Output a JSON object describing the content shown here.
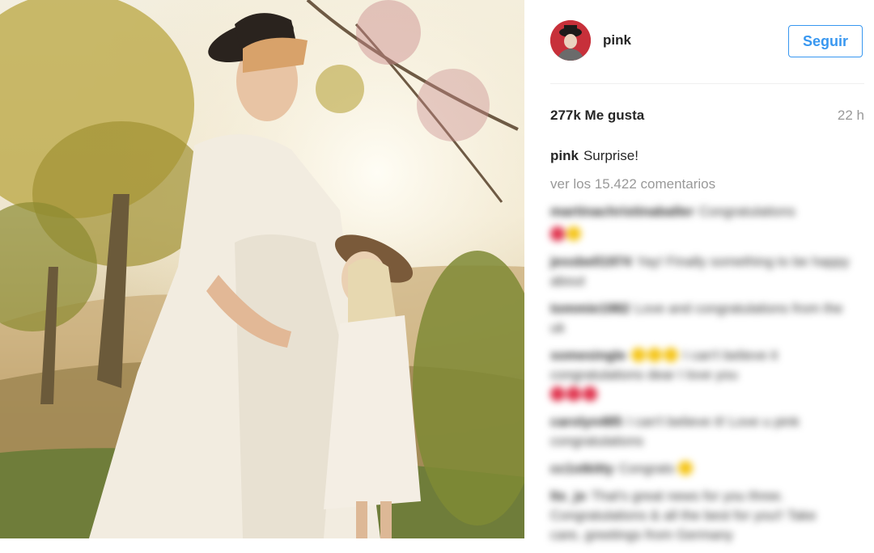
{
  "post": {
    "username": "pink",
    "follow_label": "Seguir",
    "likes": "277k Me gusta",
    "time_ago": "22 h",
    "caption_author": "pink",
    "caption_text": "Surprise!",
    "view_comments": "ver los 15.422 comentarios"
  },
  "comments": [
    {
      "user": "martinachristinaballer",
      "text": "Congratulations"
    },
    {
      "user": "",
      "text": ""
    },
    {
      "user": "jessbell1974",
      "text": "Yay! Finally something to be happy about"
    },
    {
      "user": "tommie1982",
      "text": "Love and congratulations from the uk"
    },
    {
      "user": "somesingle",
      "text": "I can't believe it congratulations dear I love you"
    },
    {
      "user": "carolyn485",
      "text": "I can't believe it! Love u pink congratulations"
    },
    {
      "user": "cc1stkitty",
      "text": "Congrats"
    },
    {
      "user": "ltx_jo",
      "text": "That's great news for you three. Congratulations & all the best for you!! Take care, greetings from Germany"
    }
  ],
  "colors": {
    "accent": "#3897f0",
    "text": "#262626",
    "muted": "#999999"
  }
}
